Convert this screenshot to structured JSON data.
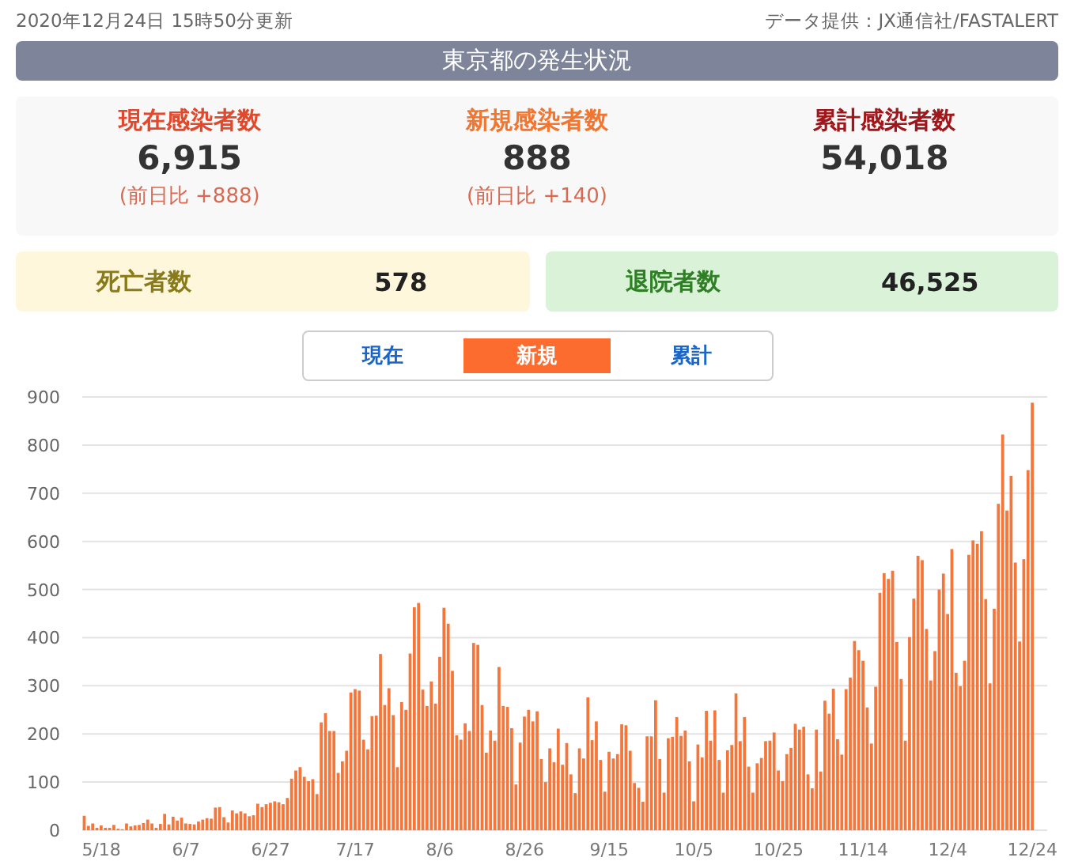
{
  "header": {
    "updated": "2020年12月24日 15時50分更新",
    "source": "データ提供：JX通信社/FASTALERT"
  },
  "title": "東京都の発生状況",
  "stats": [
    {
      "kind": "current",
      "label": "現在感染者数",
      "value": "6,915",
      "change": "(前日比 +888)"
    },
    {
      "kind": "new",
      "label": "新規感染者数",
      "value": "888",
      "change": "(前日比 +140)"
    },
    {
      "kind": "cumulative",
      "label": "累計感染者数",
      "value": "54,018"
    }
  ],
  "totals": [
    {
      "kind": "deaths",
      "label": "死亡者数",
      "value": "578"
    },
    {
      "kind": "recovered",
      "label": "退院者数",
      "value": "46,525"
    }
  ],
  "tabs": [
    {
      "label": "現在",
      "selected": false
    },
    {
      "label": "新規",
      "selected": true
    },
    {
      "label": "累計",
      "selected": false
    }
  ],
  "chart": {
    "chart_data": {
      "type": "bar",
      "grid": true,
      "categories": [
        null,
        null,
        null,
        null,
        "5/18",
        null,
        null,
        null,
        null,
        null,
        null,
        null,
        null,
        null,
        null,
        null,
        null,
        null,
        null,
        null,
        null,
        null,
        null,
        null,
        "6/7",
        null,
        null,
        null,
        null,
        null,
        null,
        null,
        null,
        null,
        null,
        null,
        null,
        null,
        null,
        null,
        null,
        null,
        null,
        null,
        "6/27",
        null,
        null,
        null,
        null,
        null,
        null,
        null,
        null,
        null,
        null,
        null,
        null,
        null,
        null,
        null,
        null,
        null,
        null,
        null,
        "7/17",
        null,
        null,
        null,
        null,
        null,
        null,
        null,
        null,
        null,
        null,
        null,
        null,
        null,
        null,
        null,
        null,
        null,
        null,
        null,
        "8/6",
        null,
        null,
        null,
        null,
        null,
        null,
        null,
        null,
        null,
        null,
        null,
        null,
        null,
        null,
        null,
        null,
        null,
        null,
        null,
        "8/26",
        null,
        null,
        null,
        null,
        null,
        null,
        null,
        null,
        null,
        null,
        null,
        null,
        null,
        null,
        null,
        null,
        null,
        null,
        null,
        "9/15",
        null,
        null,
        null,
        null,
        null,
        null,
        null,
        null,
        null,
        null,
        null,
        null,
        null,
        null,
        null,
        null,
        null,
        null,
        null,
        "10/5",
        null,
        null,
        null,
        null,
        null,
        null,
        null,
        null,
        null,
        null,
        null,
        null,
        null,
        null,
        null,
        null,
        null,
        null,
        null,
        "10/25",
        null,
        null,
        null,
        null,
        null,
        null,
        null,
        null,
        null,
        null,
        null,
        null,
        null,
        null,
        null,
        null,
        null,
        null,
        null,
        "11/14",
        null,
        null,
        null,
        null,
        null,
        null,
        null,
        null,
        null,
        null,
        null,
        null,
        null,
        null,
        null,
        null,
        null,
        null,
        null,
        "12/4",
        null,
        null,
        null,
        null,
        null,
        null,
        null,
        null,
        null,
        null,
        null,
        null,
        null,
        null,
        null,
        null,
        null,
        null,
        null,
        "12/24"
      ],
      "series": [
        {
          "color": "#f4763a",
          "values": [
            30,
            9,
            14,
            5,
            10,
            5,
            5,
            11,
            3,
            2,
            14,
            8,
            10,
            11,
            15,
            22,
            14,
            5,
            13,
            34,
            12,
            28,
            20,
            26,
            14,
            13,
            12,
            18,
            22,
            25,
            24,
            47,
            48,
            27,
            16,
            41,
            35,
            39,
            35,
            29,
            31,
            55,
            48,
            54,
            57,
            60,
            58,
            54,
            67,
            107,
            124,
            131,
            111,
            102,
            106,
            75,
            224,
            243,
            206,
            206,
            119,
            143,
            165,
            286,
            293,
            290,
            188,
            168,
            237,
            238,
            366,
            260,
            295,
            239,
            131,
            266,
            250,
            367,
            463,
            472,
            292,
            258,
            309,
            263,
            360,
            462,
            429,
            331,
            197,
            188,
            222,
            206,
            389,
            385,
            260,
            161,
            207,
            186,
            339,
            258,
            256,
            212,
            95,
            182,
            236,
            250,
            226,
            247,
            148,
            100,
            170,
            141,
            211,
            136,
            181,
            116,
            77,
            170,
            149,
            276,
            187,
            226,
            146,
            80,
            163,
            149,
            158,
            220,
            218,
            165,
            98,
            88,
            59,
            195,
            195,
            270,
            148,
            78,
            191,
            194,
            235,
            196,
            207,
            143,
            60,
            178,
            151,
            248,
            186,
            249,
            146,
            78,
            166,
            177,
            284,
            185,
            235,
            132,
            78,
            139,
            150,
            185,
            186,
            203,
            124,
            102,
            158,
            171,
            221,
            209,
            215,
            116,
            87,
            209,
            122,
            269,
            242,
            294,
            189,
            157,
            293,
            317,
            393,
            374,
            352,
            255,
            180,
            298,
            493,
            534,
            522,
            539,
            391,
            314,
            186,
            401,
            481,
            570,
            561,
            418,
            311,
            372,
            500,
            533,
            449,
            584,
            327,
            299,
            352,
            572,
            602,
            595,
            621,
            480,
            305,
            460,
            678,
            822,
            664,
            736,
            556,
            392,
            563,
            748,
            888
          ]
        }
      ],
      "ylim": [
        0,
        900
      ],
      "yticks": [
        0,
        100,
        200,
        300,
        400,
        500,
        600,
        700,
        800,
        900
      ]
    }
  }
}
